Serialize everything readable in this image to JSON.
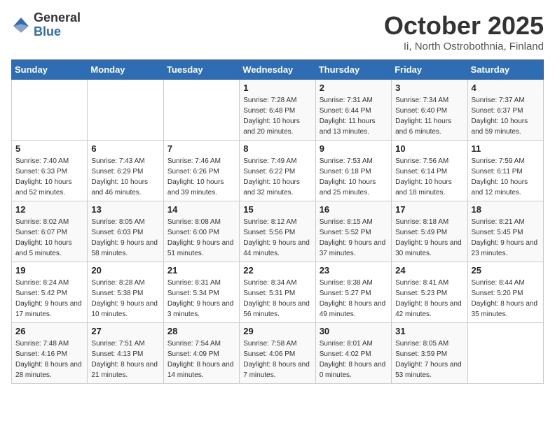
{
  "logo": {
    "general": "General",
    "blue": "Blue"
  },
  "title": "October 2025",
  "location": "Ii, North Ostrobothnia, Finland",
  "days_of_week": [
    "Sunday",
    "Monday",
    "Tuesday",
    "Wednesday",
    "Thursday",
    "Friday",
    "Saturday"
  ],
  "weeks": [
    [
      {
        "day": "",
        "sunrise": "",
        "sunset": "",
        "daylight": ""
      },
      {
        "day": "",
        "sunrise": "",
        "sunset": "",
        "daylight": ""
      },
      {
        "day": "",
        "sunrise": "",
        "sunset": "",
        "daylight": ""
      },
      {
        "day": "1",
        "sunrise": "Sunrise: 7:28 AM",
        "sunset": "Sunset: 6:48 PM",
        "daylight": "Daylight: 10 hours and 20 minutes."
      },
      {
        "day": "2",
        "sunrise": "Sunrise: 7:31 AM",
        "sunset": "Sunset: 6:44 PM",
        "daylight": "Daylight: 11 hours and 13 minutes."
      },
      {
        "day": "3",
        "sunrise": "Sunrise: 7:34 AM",
        "sunset": "Sunset: 6:40 PM",
        "daylight": "Daylight: 11 hours and 6 minutes."
      },
      {
        "day": "4",
        "sunrise": "Sunrise: 7:37 AM",
        "sunset": "Sunset: 6:37 PM",
        "daylight": "Daylight: 10 hours and 59 minutes."
      }
    ],
    [
      {
        "day": "5",
        "sunrise": "Sunrise: 7:40 AM",
        "sunset": "Sunset: 6:33 PM",
        "daylight": "Daylight: 10 hours and 52 minutes."
      },
      {
        "day": "6",
        "sunrise": "Sunrise: 7:43 AM",
        "sunset": "Sunset: 6:29 PM",
        "daylight": "Daylight: 10 hours and 46 minutes."
      },
      {
        "day": "7",
        "sunrise": "Sunrise: 7:46 AM",
        "sunset": "Sunset: 6:26 PM",
        "daylight": "Daylight: 10 hours and 39 minutes."
      },
      {
        "day": "8",
        "sunrise": "Sunrise: 7:49 AM",
        "sunset": "Sunset: 6:22 PM",
        "daylight": "Daylight: 10 hours and 32 minutes."
      },
      {
        "day": "9",
        "sunrise": "Sunrise: 7:53 AM",
        "sunset": "Sunset: 6:18 PM",
        "daylight": "Daylight: 10 hours and 25 minutes."
      },
      {
        "day": "10",
        "sunrise": "Sunrise: 7:56 AM",
        "sunset": "Sunset: 6:14 PM",
        "daylight": "Daylight: 10 hours and 18 minutes."
      },
      {
        "day": "11",
        "sunrise": "Sunrise: 7:59 AM",
        "sunset": "Sunset: 6:11 PM",
        "daylight": "Daylight: 10 hours and 12 minutes."
      }
    ],
    [
      {
        "day": "12",
        "sunrise": "Sunrise: 8:02 AM",
        "sunset": "Sunset: 6:07 PM",
        "daylight": "Daylight: 10 hours and 5 minutes."
      },
      {
        "day": "13",
        "sunrise": "Sunrise: 8:05 AM",
        "sunset": "Sunset: 6:03 PM",
        "daylight": "Daylight: 9 hours and 58 minutes."
      },
      {
        "day": "14",
        "sunrise": "Sunrise: 8:08 AM",
        "sunset": "Sunset: 6:00 PM",
        "daylight": "Daylight: 9 hours and 51 minutes."
      },
      {
        "day": "15",
        "sunrise": "Sunrise: 8:12 AM",
        "sunset": "Sunset: 5:56 PM",
        "daylight": "Daylight: 9 hours and 44 minutes."
      },
      {
        "day": "16",
        "sunrise": "Sunrise: 8:15 AM",
        "sunset": "Sunset: 5:52 PM",
        "daylight": "Daylight: 9 hours and 37 minutes."
      },
      {
        "day": "17",
        "sunrise": "Sunrise: 8:18 AM",
        "sunset": "Sunset: 5:49 PM",
        "daylight": "Daylight: 9 hours and 30 minutes."
      },
      {
        "day": "18",
        "sunrise": "Sunrise: 8:21 AM",
        "sunset": "Sunset: 5:45 PM",
        "daylight": "Daylight: 9 hours and 23 minutes."
      }
    ],
    [
      {
        "day": "19",
        "sunrise": "Sunrise: 8:24 AM",
        "sunset": "Sunset: 5:42 PM",
        "daylight": "Daylight: 9 hours and 17 minutes."
      },
      {
        "day": "20",
        "sunrise": "Sunrise: 8:28 AM",
        "sunset": "Sunset: 5:38 PM",
        "daylight": "Daylight: 9 hours and 10 minutes."
      },
      {
        "day": "21",
        "sunrise": "Sunrise: 8:31 AM",
        "sunset": "Sunset: 5:34 PM",
        "daylight": "Daylight: 9 hours and 3 minutes."
      },
      {
        "day": "22",
        "sunrise": "Sunrise: 8:34 AM",
        "sunset": "Sunset: 5:31 PM",
        "daylight": "Daylight: 8 hours and 56 minutes."
      },
      {
        "day": "23",
        "sunrise": "Sunrise: 8:38 AM",
        "sunset": "Sunset: 5:27 PM",
        "daylight": "Daylight: 8 hours and 49 minutes."
      },
      {
        "day": "24",
        "sunrise": "Sunrise: 8:41 AM",
        "sunset": "Sunset: 5:23 PM",
        "daylight": "Daylight: 8 hours and 42 minutes."
      },
      {
        "day": "25",
        "sunrise": "Sunrise: 8:44 AM",
        "sunset": "Sunset: 5:20 PM",
        "daylight": "Daylight: 8 hours and 35 minutes."
      }
    ],
    [
      {
        "day": "26",
        "sunrise": "Sunrise: 7:48 AM",
        "sunset": "Sunset: 4:16 PM",
        "daylight": "Daylight: 8 hours and 28 minutes."
      },
      {
        "day": "27",
        "sunrise": "Sunrise: 7:51 AM",
        "sunset": "Sunset: 4:13 PM",
        "daylight": "Daylight: 8 hours and 21 minutes."
      },
      {
        "day": "28",
        "sunrise": "Sunrise: 7:54 AM",
        "sunset": "Sunset: 4:09 PM",
        "daylight": "Daylight: 8 hours and 14 minutes."
      },
      {
        "day": "29",
        "sunrise": "Sunrise: 7:58 AM",
        "sunset": "Sunset: 4:06 PM",
        "daylight": "Daylight: 8 hours and 7 minutes."
      },
      {
        "day": "30",
        "sunrise": "Sunrise: 8:01 AM",
        "sunset": "Sunset: 4:02 PM",
        "daylight": "Daylight: 8 hours and 0 minutes."
      },
      {
        "day": "31",
        "sunrise": "Sunrise: 8:05 AM",
        "sunset": "Sunset: 3:59 PM",
        "daylight": "Daylight: 7 hours and 53 minutes."
      },
      {
        "day": "",
        "sunrise": "",
        "sunset": "",
        "daylight": ""
      }
    ]
  ]
}
